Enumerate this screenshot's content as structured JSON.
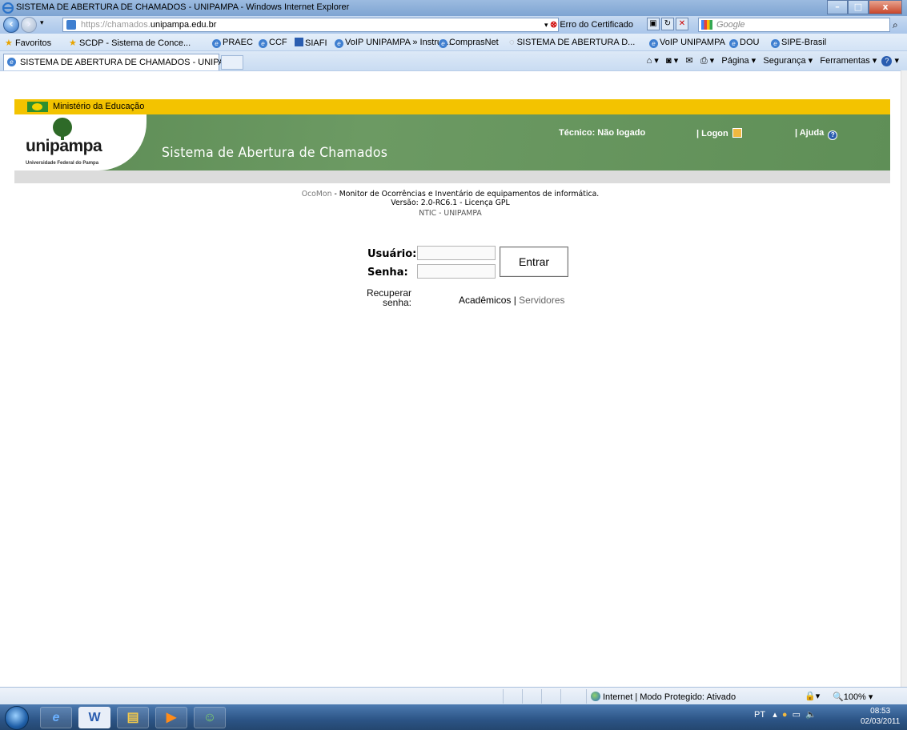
{
  "window": {
    "title": "SISTEMA DE ABERTURA DE CHAMADOS - UNIPAMPA - Windows Internet Explorer",
    "minimize": "–",
    "maximize": "□",
    "close": "x"
  },
  "addressbar": {
    "url_prefix": "https://chamados.",
    "url_domain": "unipampa.edu.br",
    "cert_error": "Erro do Certificado",
    "search_placeholder": "Google"
  },
  "favorites": {
    "label": "Favoritos",
    "items": [
      "SCDP - Sistema de Conce...",
      "PRAEC",
      "CCF",
      "SIAFI",
      "VoIP UNIPAMPA » Instruç...",
      "ComprasNet",
      "SISTEMA DE ABERTURA D...",
      "VoIP UNIPAMPA",
      "DOU",
      "SIPE-Brasil"
    ]
  },
  "tabs": {
    "active": "SISTEMA DE ABERTURA DE CHAMADOS - UNIPA...",
    "commands": [
      "Página ▾",
      "Segurança ▾",
      "Ferramentas ▾"
    ]
  },
  "header": {
    "ministry": "Ministério da Educação",
    "logo_text": "unipampa",
    "logo_sub": "Universidade Federal do Pampa",
    "system_title": "Sistema de Abertura de Chamados",
    "tecnico": "Técnico: Não logado",
    "logon": "| Logon",
    "ajuda": "| Ajuda"
  },
  "info": {
    "ocomon": "OcoMon",
    "desc": " - Monitor de Ocorrências e Inventário de equipamentos de informática.",
    "version": "Versão: 2.0-RC6.1 - Licença GPL",
    "org": "NTIC - UNIPAMPA"
  },
  "login": {
    "user_label": "Usuário:",
    "pass_label": "Senha:",
    "user_value": "",
    "pass_value": "",
    "submit": "Entrar",
    "recover_label_1": "Recuperar",
    "recover_label_2": "senha:",
    "recover_academicos": "Acadêmicos",
    "recover_sep": " | ",
    "recover_servidores": "Servidores"
  },
  "statusbar": {
    "zone": "Internet | Modo Protegido: Ativado",
    "zoom": "100%"
  },
  "taskbar": {
    "lang": "PT",
    "time": "08:53",
    "date": "02/03/2011"
  }
}
